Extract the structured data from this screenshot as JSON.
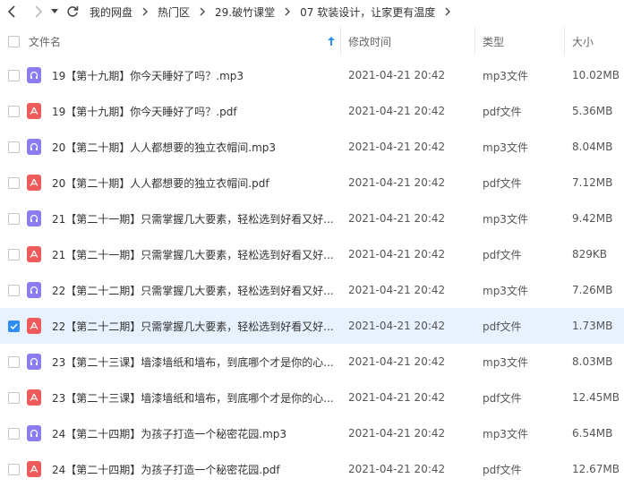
{
  "breadcrumb": [
    "我的网盘",
    "热门区",
    "29.破竹课堂",
    "07 软装设计，让家更有温度"
  ],
  "columns": {
    "name": "文件名",
    "time": "修改时间",
    "type": "类型",
    "size": "大小"
  },
  "colors": {
    "accent": "#2f8ef5",
    "mp3_icon": "#8b7cf0",
    "pdf_icon": "#ef5b5b",
    "selected_row": "#e8f2fe"
  },
  "files": [
    {
      "name": "19【第十九期】你今天睡好了吗？.mp3",
      "time": "2021-04-21 20:42",
      "type": "mp3文件",
      "size": "10.02MB",
      "kind": "mp3",
      "selected": false
    },
    {
      "name": "19【第十九期】你今天睡好了吗？.pdf",
      "time": "2021-04-21 20:42",
      "type": "pdf文件",
      "size": "5.36MB",
      "kind": "pdf",
      "selected": false
    },
    {
      "name": "20【第二十期】人人都想要的独立衣帽间.mp3",
      "time": "2021-04-21 20:42",
      "type": "mp3文件",
      "size": "8.04MB",
      "kind": "mp3",
      "selected": false
    },
    {
      "name": "20【第二十期】人人都想要的独立衣帽间.pdf",
      "time": "2021-04-21 20:42",
      "type": "pdf文件",
      "size": "7.12MB",
      "kind": "pdf",
      "selected": false
    },
    {
      "name": "21【第二十一期】只需掌握几大要素，轻松选到好看又好...",
      "time": "2021-04-21 20:42",
      "type": "mp3文件",
      "size": "9.42MB",
      "kind": "mp3",
      "selected": false
    },
    {
      "name": "21【第二十一期】只需掌握几大要素，轻松选到好看又好...",
      "time": "2021-04-21 20:42",
      "type": "pdf文件",
      "size": "829KB",
      "kind": "pdf",
      "selected": false
    },
    {
      "name": "22【第二十二期】只需掌握几大要素，轻松选到好看又好...",
      "time": "2021-04-21 20:42",
      "type": "mp3文件",
      "size": "7.26MB",
      "kind": "mp3",
      "selected": false
    },
    {
      "name": "22【第二十二期】只需掌握几大要素，轻松选到好看又好...",
      "time": "2021-04-21 20:42",
      "type": "pdf文件",
      "size": "1.73MB",
      "kind": "pdf",
      "selected": true
    },
    {
      "name": "23【第二十三课】墙漆墙纸和墙布，到底哪个才是你的心...",
      "time": "2021-04-21 20:42",
      "type": "mp3文件",
      "size": "8.03MB",
      "kind": "mp3",
      "selected": false
    },
    {
      "name": "23【第二十三课】墙漆墙纸和墙布，到底哪个才是你的心...",
      "time": "2021-04-21 20:42",
      "type": "pdf文件",
      "size": "12.45MB",
      "kind": "pdf",
      "selected": false
    },
    {
      "name": "24【第二十四期】为孩子打造一个秘密花园.mp3",
      "time": "2021-04-21 20:42",
      "type": "mp3文件",
      "size": "6.54MB",
      "kind": "mp3",
      "selected": false
    },
    {
      "name": "24【第二十四期】为孩子打造一个秘密花园.pdf",
      "time": "2021-04-21 20:42",
      "type": "pdf文件",
      "size": "12.67MB",
      "kind": "pdf",
      "selected": false
    }
  ]
}
